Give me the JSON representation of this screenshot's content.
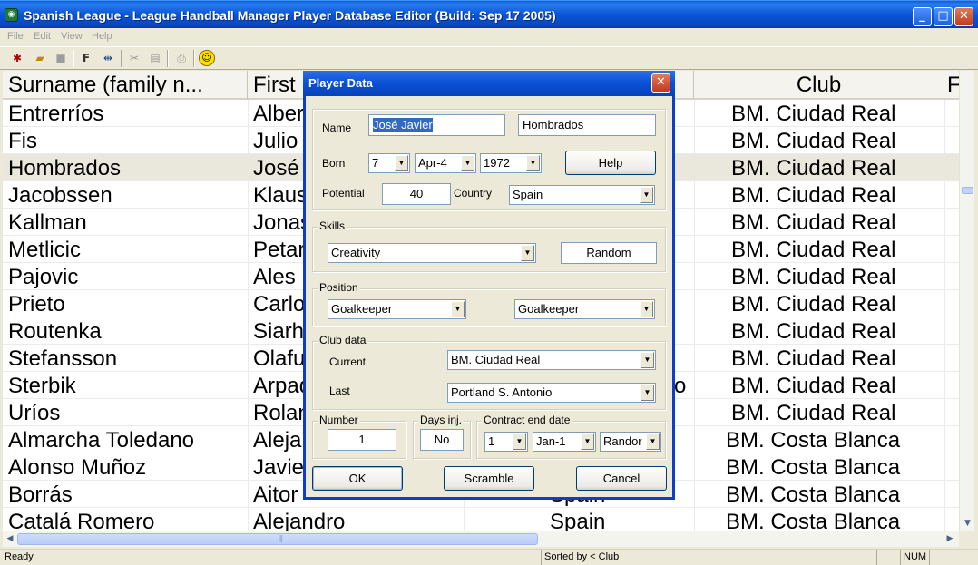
{
  "window": {
    "title": "Spanish League - League Handball Manager Player Database Editor (Build: Sep 17 2005)",
    "minimize": "_",
    "maximize": "□",
    "close": "✕"
  },
  "menu": {
    "file": "File",
    "edit": "Edit",
    "view": "View",
    "help": "Help"
  },
  "toolbar": {
    "f_label": "F"
  },
  "list": {
    "columns": [
      "Surname (family n...",
      "First",
      "",
      "Club",
      "F"
    ],
    "rows": [
      {
        "surname": "Entrerríos",
        "first": "Alberto",
        "country": "",
        "club": "BM. Ciudad Real"
      },
      {
        "surname": "Fis",
        "first": "Julio",
        "country": "",
        "club": "BM. Ciudad Real"
      },
      {
        "surname": "Hombrados",
        "first": "José",
        "country": "",
        "club": "BM. Ciudad Real"
      },
      {
        "surname": "Jacobssen",
        "first": "Klaus",
        "country": "",
        "club": "BM. Ciudad Real"
      },
      {
        "surname": "Kallman",
        "first": "Jonas",
        "country": "",
        "club": "BM. Ciudad Real"
      },
      {
        "surname": "Metlicic",
        "first": "Petar",
        "country": "",
        "club": "BM. Ciudad Real"
      },
      {
        "surname": "Pajovic",
        "first": "Ales",
        "country": "",
        "club": "BM. Ciudad Real"
      },
      {
        "surname": "Prieto",
        "first": "Carlos",
        "country": "",
        "club": "BM. Ciudad Real"
      },
      {
        "surname": "Routenka",
        "first": "Siarhei",
        "country": "",
        "club": "BM. Ciudad Real"
      },
      {
        "surname": "Stefansson",
        "first": "Olafur",
        "country": "",
        "club": "BM. Ciudad Real"
      },
      {
        "surname": "Sterbik",
        "first": "Arpad",
        "country": "o",
        "club": "BM. Ciudad Real"
      },
      {
        "surname": "Uríos",
        "first": "Rolando",
        "country": "",
        "club": "BM. Ciudad Real"
      },
      {
        "surname": "Almarcha Toledano",
        "first": "Alejandro",
        "country": "",
        "club": "BM. Costa Blanca"
      },
      {
        "surname": "Alonso Muñoz",
        "first": "Javier",
        "country": "",
        "club": "BM. Costa Blanca"
      },
      {
        "surname": "Borrás",
        "first": "Aitor",
        "country": "Spain",
        "club": "BM. Costa Blanca"
      },
      {
        "surname": "Catalá Romero",
        "first": "Alejandro",
        "country": "Spain",
        "club": "BM. Costa Blanca"
      }
    ]
  },
  "status": {
    "ready": "Ready",
    "sorted": "Sorted by < Club",
    "num": "NUM"
  },
  "dialog": {
    "title": "Player Data",
    "close": "✕",
    "name_label": "Name",
    "first_name": "José Javier",
    "surname": "Hombrados",
    "born_label": "Born",
    "born_day": "7",
    "born_month": "Apr-4",
    "born_year": "1972",
    "help_button": "Help",
    "potential_label": "Potential",
    "potential": "40",
    "country_label": "Country",
    "country": "Spain",
    "skills_legend": "Skills",
    "skill": "Creativity",
    "random_button": "Random",
    "position_legend": "Position",
    "position1": "Goalkeeper",
    "position2": "Goalkeeper",
    "club_legend": "Club data",
    "current_label": "Current",
    "current_club": "BM. Ciudad Real",
    "last_label": "Last",
    "last_club": "Portland S. Antonio",
    "number_legend": "Number",
    "number": "1",
    "days_legend": "Days inj.",
    "days": "No",
    "contract_legend": "Contract end date",
    "contract_day": "1",
    "contract_month": "Jan-1",
    "contract_year": "Randor",
    "ok_button": "OK",
    "scramble_button": "Scramble",
    "cancel_button": "Cancel"
  }
}
